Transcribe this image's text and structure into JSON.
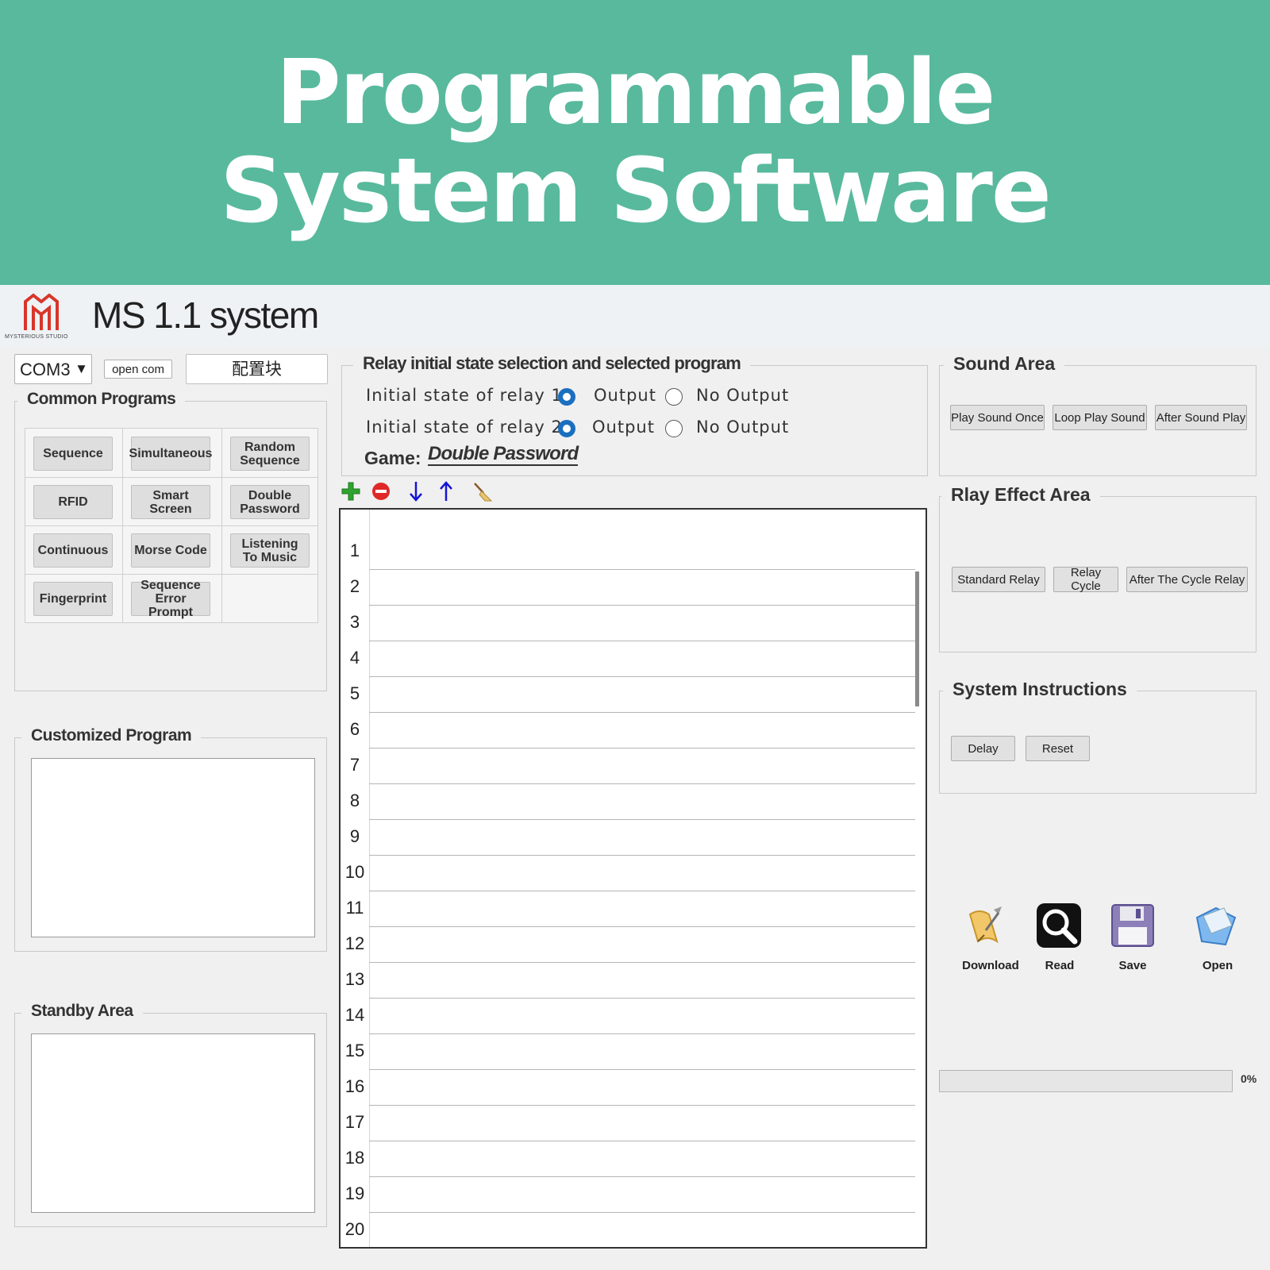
{
  "banner": {
    "line1": "Programmable",
    "line2": "System Software"
  },
  "header": {
    "logo_text": "MYSTERIOUS STUDIO",
    "title": "MS 1.1 system"
  },
  "toolbar": {
    "com_port": "COM3",
    "open_com_label": "open com",
    "config_label": "配置块"
  },
  "common_programs": {
    "legend": "Common Programs",
    "buttons": [
      [
        "Sequence",
        "Simultaneous",
        "Random\nSequence"
      ],
      [
        "RFID",
        "Smart\nScreen",
        "Double\nPassword"
      ],
      [
        "Continuous",
        "Morse Code",
        "Listening\nTo Music"
      ],
      [
        "Fingerprint",
        "Sequence\nError Prompt"
      ]
    ]
  },
  "customized_program": {
    "legend": "Customized Program"
  },
  "standby_area": {
    "legend": "Standby Area"
  },
  "relay": {
    "legend": "Relay initial state selection and selected program",
    "relay1_label": "Initial state of relay 1",
    "relay2_label": "Initial state of relay 2",
    "output_label": "Output",
    "no_output_label": "No Output",
    "relay1_selected": "Output",
    "relay2_selected": "Output",
    "game_label": "Game:",
    "game_value": "Double Password"
  },
  "list_toolbar": {
    "icons": [
      "add-icon",
      "remove-icon",
      "move-down-icon",
      "move-up-icon",
      "clear-broom-icon"
    ]
  },
  "program_table": {
    "rows": [
      "1",
      "2",
      "3",
      "4",
      "5",
      "6",
      "7",
      "8",
      "9",
      "10",
      "11",
      "12",
      "13",
      "14",
      "15",
      "16",
      "17",
      "18",
      "19",
      "20"
    ]
  },
  "sound_area": {
    "legend": "Sound Area",
    "buttons": [
      "Play Sound Once",
      "Loop Play Sound",
      "After Sound Play"
    ]
  },
  "relay_effect_area": {
    "legend": "Rlay Effect Area",
    "buttons": [
      "Standard Relay",
      "Relay Cycle",
      "After The Cycle Relay"
    ]
  },
  "system_instructions": {
    "legend": "System Instructions",
    "buttons": [
      "Delay",
      "Reset"
    ]
  },
  "actions": {
    "download": "Download",
    "read": "Read",
    "save": "Save",
    "open": "Open"
  },
  "progress": {
    "value": 0,
    "text": "0%"
  },
  "colors": {
    "banner": "#58b99d",
    "radio_selected": "#1a6fc0",
    "logo": "#d8352a"
  }
}
